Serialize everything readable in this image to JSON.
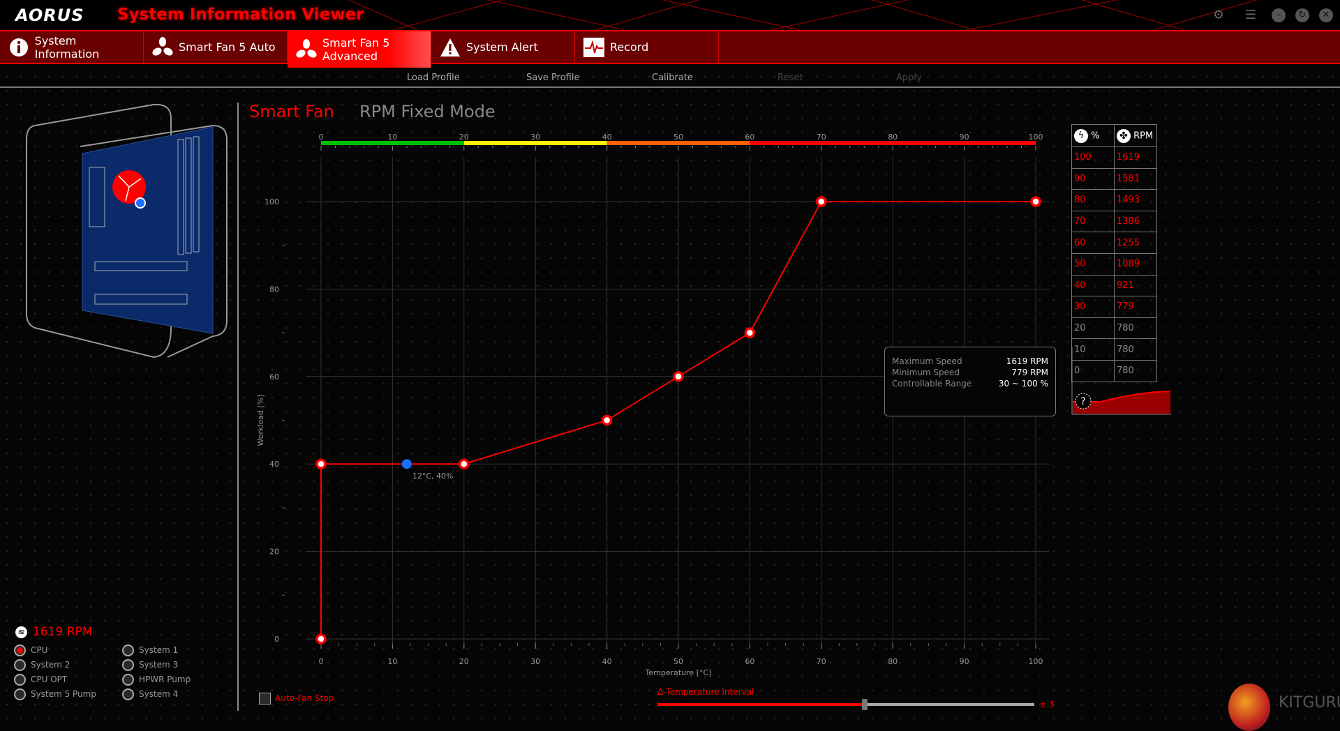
{
  "app": {
    "logo": "AORUS",
    "title": "System Information Viewer",
    "window_buttons": [
      "gear-icon",
      "list-icon",
      "minimize-icon",
      "restore-icon",
      "close-icon"
    ]
  },
  "tabs": [
    {
      "label": "System Information",
      "icon": "info-icon",
      "active": false
    },
    {
      "label": "Smart Fan 5 Auto",
      "icon": "fan-icon",
      "active": false
    },
    {
      "label": "Smart Fan 5 Advanced",
      "icon": "fan-icon",
      "active": true
    },
    {
      "label": "System Alert",
      "icon": "warning-icon",
      "active": false
    },
    {
      "label": "Record",
      "icon": "record-icon",
      "active": false
    }
  ],
  "toolbar": {
    "load": "Load Profile",
    "save": "Save Profile",
    "calibrate": "Calibrate",
    "reset": "Reset",
    "apply": "Apply"
  },
  "modes": {
    "smart_fan": "Smart Fan",
    "rpm_fixed": "RPM Fixed Mode"
  },
  "fan_status": {
    "rpm": "1619 RPM",
    "fans": [
      {
        "label": "CPU",
        "selected": true
      },
      {
        "label": "System 1",
        "selected": false
      },
      {
        "label": "System 2",
        "selected": false
      },
      {
        "label": "System 3",
        "selected": false
      },
      {
        "label": "CPU OPT",
        "selected": false
      },
      {
        "label": "HPWR Pump",
        "selected": false
      },
      {
        "label": "System 5 Pump",
        "selected": false
      },
      {
        "label": "System 4",
        "selected": false
      }
    ]
  },
  "auto_fan_stop": {
    "label": "Auto-Fan Stop",
    "checked": false
  },
  "temp_interval": {
    "label": "Δ-Temperature Interval",
    "value_label": "± 3",
    "fraction": 0.55
  },
  "rpm_table": {
    "headers": [
      "%",
      "RPM"
    ],
    "rows": [
      [
        "100",
        "1619",
        true
      ],
      [
        "90",
        "1581",
        true
      ],
      [
        "80",
        "1493",
        true
      ],
      [
        "70",
        "1386",
        true
      ],
      [
        "60",
        "1255",
        true
      ],
      [
        "50",
        "1089",
        true
      ],
      [
        "40",
        "921",
        true
      ],
      [
        "30",
        "779",
        true
      ],
      [
        "20",
        "780",
        false
      ],
      [
        "10",
        "780",
        false
      ],
      [
        "0",
        "780",
        false
      ]
    ]
  },
  "tooltip": {
    "rows": [
      [
        "Maximum Speed",
        "1619 RPM"
      ],
      [
        "Minimum Speed",
        "779 RPM"
      ],
      [
        "Controllable Range",
        "30 ~ 100 %"
      ]
    ]
  },
  "help": "?",
  "watermark": "KITGURU",
  "chart_data": {
    "type": "line",
    "xlabel": "Temperature [°C]",
    "ylabel": "Workload [%]",
    "xlim": [
      0,
      100
    ],
    "ylim": [
      0,
      100
    ],
    "xticks": [
      "0",
      "10",
      "20",
      "30",
      "40",
      "50",
      "60",
      "70",
      "80",
      "90",
      "100"
    ],
    "yticks": [
      "0",
      "20",
      "40",
      "60",
      "80",
      "100"
    ],
    "top_ticks": [
      "0",
      "10",
      "20",
      "30",
      "40",
      "50",
      "60",
      "70",
      "80",
      "90",
      "100"
    ],
    "temp_bands": [
      {
        "from": 0,
        "to": 20,
        "color": "#00c000"
      },
      {
        "from": 20,
        "to": 40,
        "color": "#ffee00"
      },
      {
        "from": 40,
        "to": 60,
        "color": "#ff6000"
      },
      {
        "from": 60,
        "to": 100,
        "color": "#ff0000"
      }
    ],
    "series": [
      {
        "name": "fan-curve",
        "color": "#ff0000",
        "points": [
          [
            0,
            0
          ],
          [
            0,
            40
          ],
          [
            20,
            40
          ],
          [
            40,
            50
          ],
          [
            50,
            60
          ],
          [
            60,
            70
          ],
          [
            70,
            100
          ],
          [
            100,
            100
          ]
        ]
      }
    ],
    "current": {
      "x": 12,
      "y": 40,
      "label": "12°C, 40%",
      "color": "#1a6fff"
    }
  }
}
